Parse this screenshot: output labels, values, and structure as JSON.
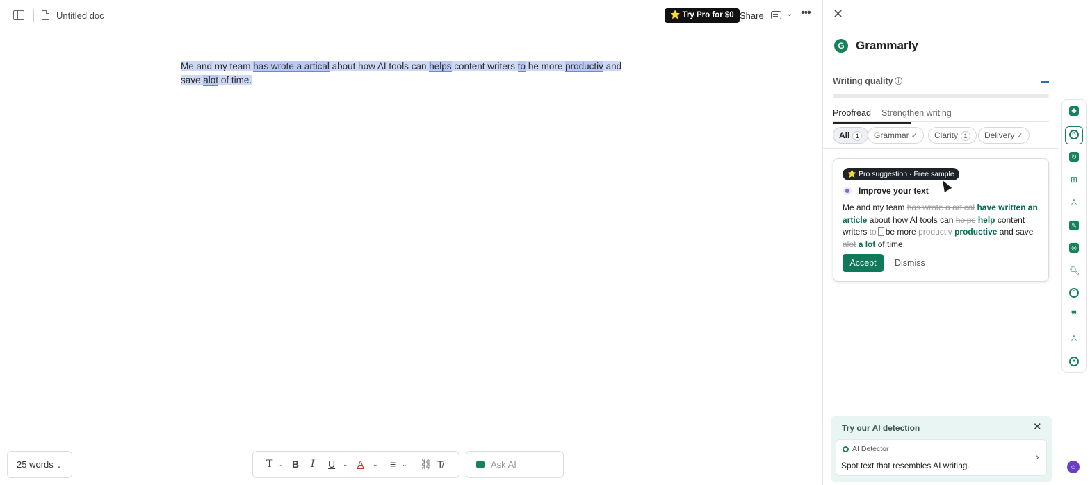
{
  "header": {
    "doc_title": "Untitled doc",
    "pro_button": "⭐ Try Pro for $0",
    "share": "Share"
  },
  "document": {
    "segments": [
      {
        "text": "Me and my team ",
        "type": "sel"
      },
      {
        "text": "has wrote a artical",
        "type": "err"
      },
      {
        "text": " about how AI tools can ",
        "type": "sel"
      },
      {
        "text": "helps",
        "type": "err"
      },
      {
        "text": " content writers ",
        "type": "sel"
      },
      {
        "text": "to",
        "type": "err"
      },
      {
        "text": " be more ",
        "type": "sel"
      },
      {
        "text": "productiv",
        "type": "err"
      },
      {
        "text": " and save ",
        "type": "sel"
      },
      {
        "text": "alot",
        "type": "err"
      },
      {
        "text": " of time.",
        "type": "sel"
      }
    ]
  },
  "bottom": {
    "word_count": "25 words",
    "ask_ai_placeholder": "Ask AI"
  },
  "grammarly": {
    "title": "Grammarly",
    "logo_letter": "G",
    "writing_quality": "Writing quality",
    "tabs": {
      "proofread": "Proofread",
      "strengthen": "Strengthen writing"
    },
    "chips": {
      "all": "All",
      "all_count": "1",
      "grammar": "Grammar",
      "clarity": "Clarity",
      "clarity_count": "1",
      "delivery": "Delivery"
    },
    "card": {
      "badge": "⭐ Pro suggestion · Free sample",
      "title": "Improve your text",
      "s1": "Me and my team ",
      "d1": "has wrote a artical",
      "i1": "have written an article",
      "s2": " about how AI tools can ",
      "d2": "helps",
      "i2": "help",
      "s3": " content writers ",
      "d3": "to",
      "s4": "be more ",
      "d4": "productiv",
      "i4": "productive",
      "s5": " and save ",
      "d5": "alot",
      "i5": "a lot",
      "s6": " of time.",
      "accept": "Accept",
      "dismiss": "Dismiss"
    },
    "ai_detection": {
      "title": "Try our AI detection",
      "label": "AI Detector",
      "text": "Spot text that resembles AI writing."
    }
  },
  "colors": {
    "brand_green": "#15825a",
    "accept_green": "#0f7a5a",
    "highlight": "#cdd8f5"
  }
}
